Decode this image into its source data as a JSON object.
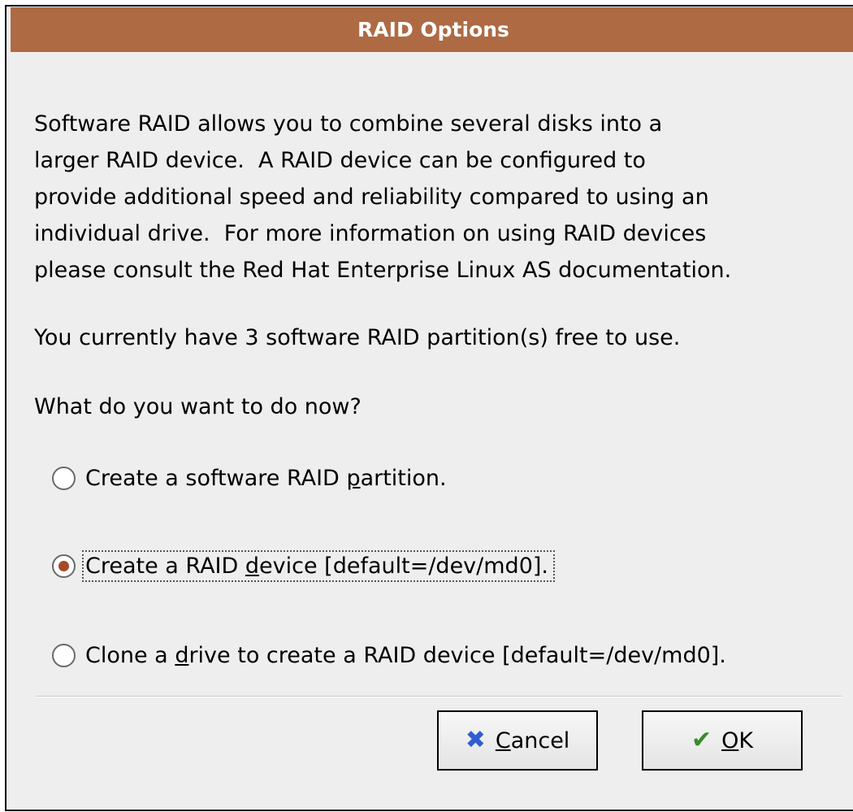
{
  "dialog": {
    "title": "RAID Options"
  },
  "body": {
    "description": "Software RAID allows you to combine several disks into a\nlarger RAID device.  A RAID device can be configured to\nprovide additional speed and reliability compared to using an\nindividual drive.  For more information on using RAID devices\nplease consult the Red Hat Enterprise Linux AS documentation.",
    "status": "You currently have 3 software RAID partition(s) free to use.",
    "question": "What do you want to do now?"
  },
  "options": [
    {
      "label_pre": "Create a software RAID ",
      "mnemonic": "p",
      "label_post": "artition.",
      "selected": false
    },
    {
      "label_pre": "Create a RAID ",
      "mnemonic": "d",
      "label_post": "evice [default=/dev/md0].",
      "selected": true
    },
    {
      "label_pre": "Clone a ",
      "mnemonic": "d",
      "label_post": "rive to create a RAID device [default=/dev/md0].",
      "selected": false
    }
  ],
  "buttons": {
    "cancel": {
      "mnemonic": "C",
      "rest": "ancel",
      "icon": "cancel-x-icon"
    },
    "ok": {
      "mnemonic": "O",
      "rest": "K",
      "icon": "checkmark-icon"
    }
  },
  "colors": {
    "titlebar": "#ae6a43",
    "dialog_bg": "#eeeeee",
    "radio_dot": "#a64a2a"
  }
}
